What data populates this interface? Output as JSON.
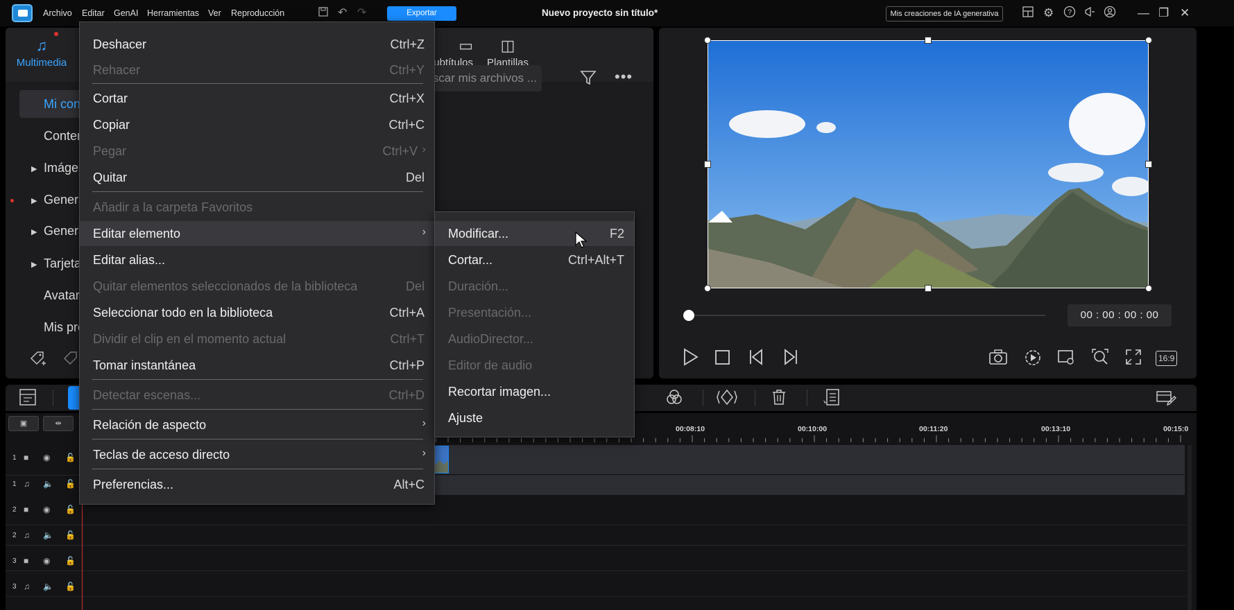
{
  "titlebar": {
    "menu": [
      "Archivo",
      "Editar",
      "GenAI",
      "Herramientas",
      "Ver",
      "Reproducción"
    ],
    "export_label": "Exportar",
    "project_title": "Nuevo proyecto sin título*",
    "ai_creations_label": "Mis creaciones de IA generativa"
  },
  "library": {
    "tabs": [
      {
        "label": "Multimedia",
        "icon": "media-icon",
        "active": true
      },
      {
        "label": "Subtítulos",
        "icon": "subtitles-icon",
        "active": false
      },
      {
        "label": "Plantillas",
        "icon": "templates-icon",
        "active": false
      }
    ],
    "search_placeholder": "Buscar mis archivos ...",
    "tree": [
      {
        "label": "Mi contenido",
        "selected": true,
        "expandable": false
      },
      {
        "label": "Contenido",
        "selected": false,
        "expandable": false
      },
      {
        "label": "Imágenes",
        "selected": false,
        "expandable": true
      },
      {
        "label": "Generado",
        "selected": false,
        "expandable": true
      },
      {
        "label": "Generado",
        "selected": false,
        "expandable": true
      },
      {
        "label": "Tarjetas",
        "selected": false,
        "expandable": true
      },
      {
        "label": "Avatares",
        "selected": false,
        "expandable": false
      },
      {
        "label": "Mis proyectos",
        "selected": false,
        "expandable": false
      }
    ]
  },
  "preview": {
    "timecode": "00 : 00 : 00 : 00",
    "aspect_label": "16:9"
  },
  "timeline": {
    "ruler_labels": [
      "00:08:10",
      "00:10:00",
      "00:11:20",
      "00:13:10",
      "00:15:0"
    ],
    "tracks": [
      {
        "num": "1",
        "type": "video"
      },
      {
        "num": "1",
        "type": "audio"
      },
      {
        "num": "2",
        "type": "video"
      },
      {
        "num": "2",
        "type": "audio"
      },
      {
        "num": "3",
        "type": "video"
      },
      {
        "num": "3",
        "type": "audio"
      }
    ]
  },
  "edit_menu": {
    "items": [
      {
        "label": "Deshacer",
        "shortcut": "Ctrl+Z",
        "disabled": false
      },
      {
        "label": "Rehacer",
        "shortcut": "Ctrl+Y",
        "disabled": true
      },
      {
        "label": "Cortar",
        "shortcut": "Ctrl+X",
        "disabled": false
      },
      {
        "label": "Copiar",
        "shortcut": "Ctrl+C",
        "disabled": false
      },
      {
        "label": "Pegar",
        "shortcut": "Ctrl+V",
        "disabled": true
      },
      {
        "label": "Quitar",
        "shortcut": "Del",
        "disabled": false
      },
      {
        "label": "Añadir a la carpeta Favoritos",
        "shortcut": "",
        "disabled": true
      },
      {
        "label": "Editar elemento",
        "shortcut": "",
        "disabled": false
      },
      {
        "label": "Editar alias...",
        "shortcut": "",
        "disabled": false
      },
      {
        "label": "Quitar elementos seleccionados de la biblioteca",
        "shortcut": "Del",
        "disabled": true
      },
      {
        "label": "Seleccionar todo en la biblioteca",
        "shortcut": "Ctrl+A",
        "disabled": false
      },
      {
        "label": "Dividir el clip en el momento actual",
        "shortcut": "Ctrl+T",
        "disabled": true
      },
      {
        "label": "Tomar instantánea",
        "shortcut": "Ctrl+P",
        "disabled": false
      },
      {
        "label": "Detectar escenas...",
        "shortcut": "Ctrl+D",
        "disabled": true
      },
      {
        "label": "Relación de aspecto",
        "shortcut": "",
        "disabled": false
      },
      {
        "label": "Teclas de acceso directo",
        "shortcut": "",
        "disabled": false
      },
      {
        "label": "Preferencias...",
        "shortcut": "Alt+C",
        "disabled": false
      }
    ]
  },
  "edit_item_submenu": {
    "items": [
      {
        "label": "Modificar...",
        "shortcut": "F2",
        "disabled": false
      },
      {
        "label": "Cortar...",
        "shortcut": "Ctrl+Alt+T",
        "disabled": false
      },
      {
        "label": "Duración...",
        "shortcut": "",
        "disabled": true
      },
      {
        "label": "Presentación...",
        "shortcut": "",
        "disabled": true
      },
      {
        "label": "AudioDirector...",
        "shortcut": "",
        "disabled": true
      },
      {
        "label": "Editor de audio",
        "shortcut": "",
        "disabled": true
      },
      {
        "label": "Recortar imagen...",
        "shortcut": "",
        "disabled": false
      },
      {
        "label": "Ajuste",
        "shortcut": "",
        "disabled": false
      }
    ]
  },
  "colors": {
    "accent": "#1a8cff",
    "panel": "#1c1c1e",
    "menu_bg": "#2b2b2e",
    "playhead": "#d82d2d"
  }
}
